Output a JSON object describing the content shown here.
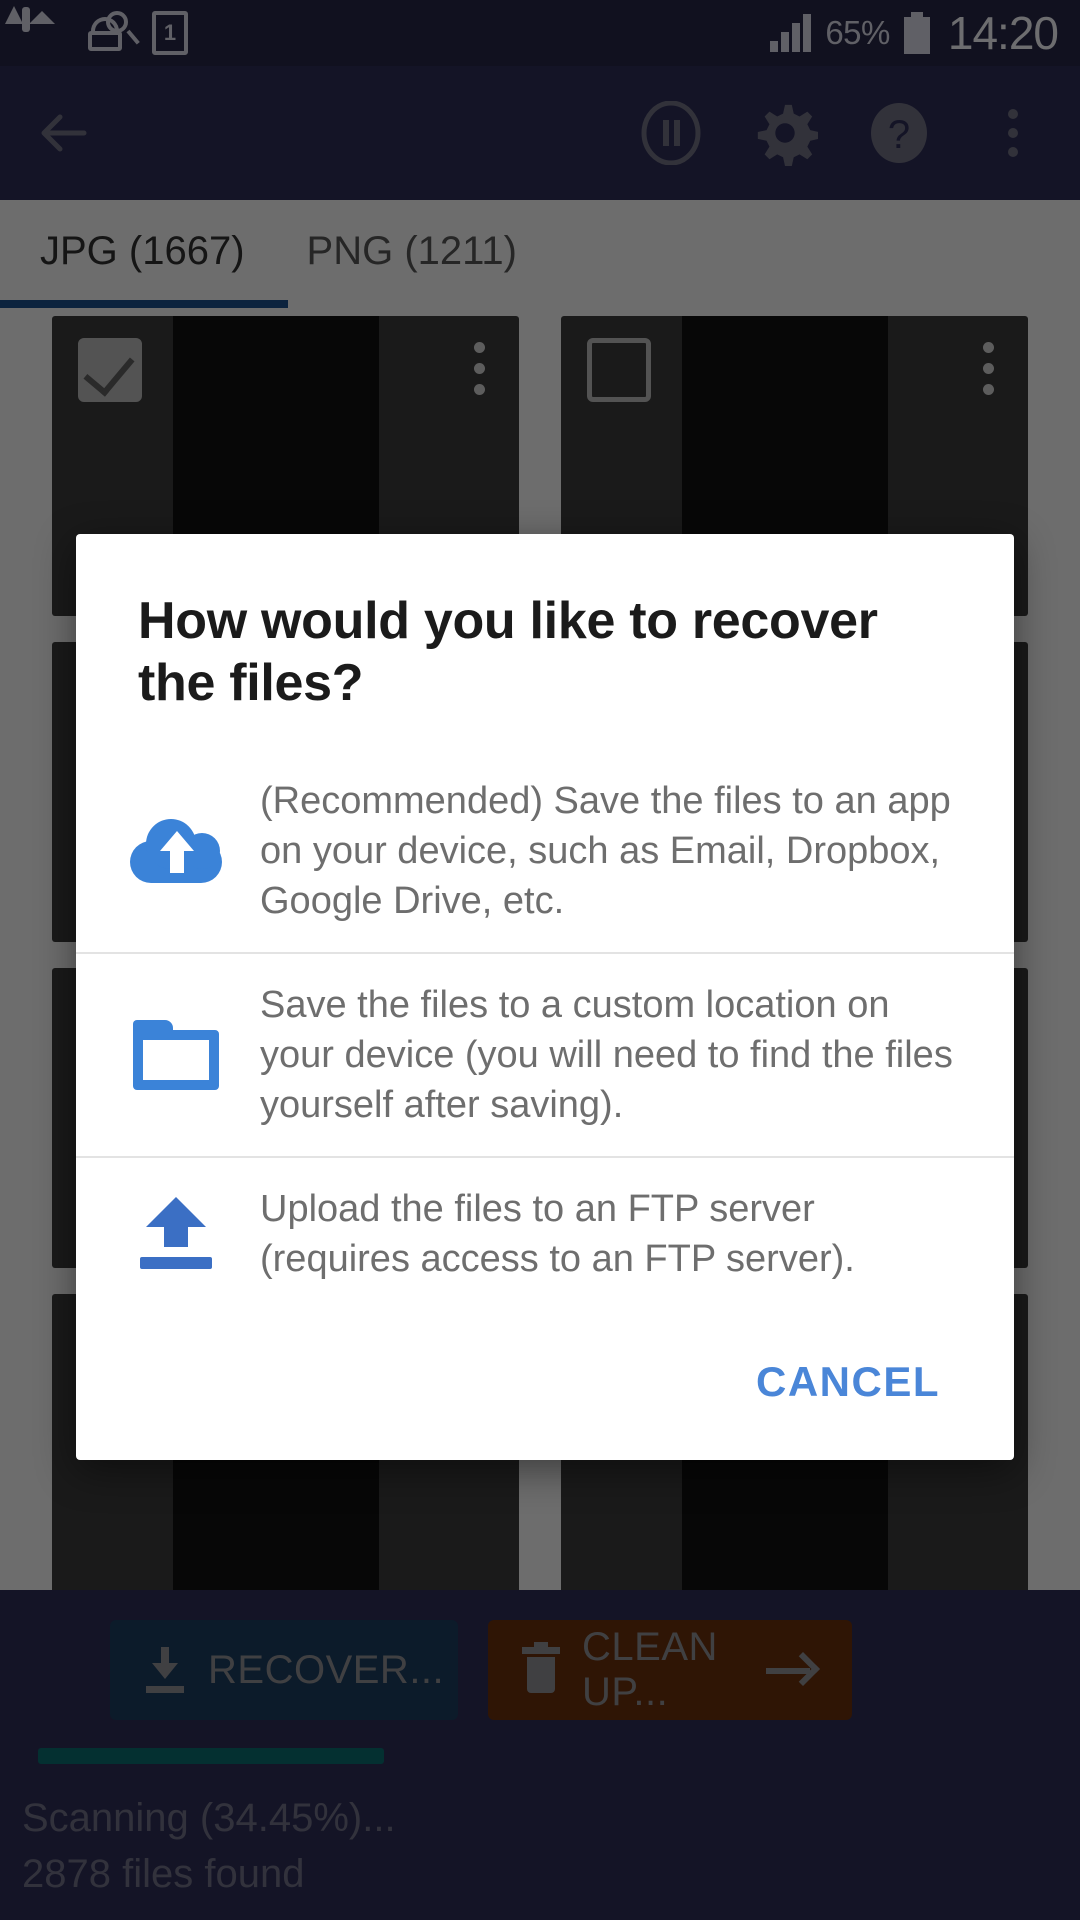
{
  "status_bar": {
    "icons": [
      "gallery-icon",
      "scan-icon",
      "sim-1-icon"
    ],
    "sim_label": "1",
    "battery_percent": "65%",
    "time": "14:20"
  },
  "app_bar": {
    "back_label": "back-arrow-icon",
    "actions": [
      "pause-icon",
      "gear-icon",
      "help-icon",
      "overflow-menu-icon"
    ]
  },
  "tabs": [
    {
      "label": "JPG (1667)",
      "active": true
    },
    {
      "label": "PNG (1211)",
      "active": false
    }
  ],
  "grid": {
    "items": [
      {
        "checked": true,
        "style": "ph-food"
      },
      {
        "checked": false,
        "style": "ph-plain"
      },
      {
        "checked": false,
        "style": "ph-plain"
      },
      {
        "checked": false,
        "style": "ph-plain"
      },
      {
        "checked": false,
        "style": "ph-plain"
      },
      {
        "checked": false,
        "style": "ph-plain"
      },
      {
        "checked": false,
        "style": "ph-dark"
      },
      {
        "checked": false,
        "style": "ph-beach"
      }
    ]
  },
  "dialog": {
    "title": "How would you like to recover the files?",
    "options": [
      {
        "icon": "cloud-upload-icon",
        "text": "(Recommended) Save the files to an app on your device, such as Email, Dropbox, Google Drive, etc."
      },
      {
        "icon": "folder-icon",
        "text": "Save the files to a custom location on your device (you will need to find the files yourself after saving)."
      },
      {
        "icon": "ftp-upload-icon",
        "text": "Upload the files to an FTP server (requires access to an FTP server)."
      }
    ],
    "cancel_label": "CANCEL"
  },
  "bottom_bar": {
    "recover_label": "RECOVER...",
    "cleanup_label": "CLEAN UP...",
    "progress_percent": 34.45,
    "status_line_1": "Scanning (34.45%)...",
    "status_line_2": "2878 files found"
  },
  "colors": {
    "status_bar_bg": "#262645",
    "app_bar_bg": "#2d2d55",
    "accent_blue": "#3b83d8",
    "cancel_blue": "#4a86d8",
    "recover_bg": "#1c3c5e",
    "cleanup_bg": "#68300d",
    "progress_fill": "#0b6a6e",
    "tab_underline": "#1c4e8a"
  }
}
